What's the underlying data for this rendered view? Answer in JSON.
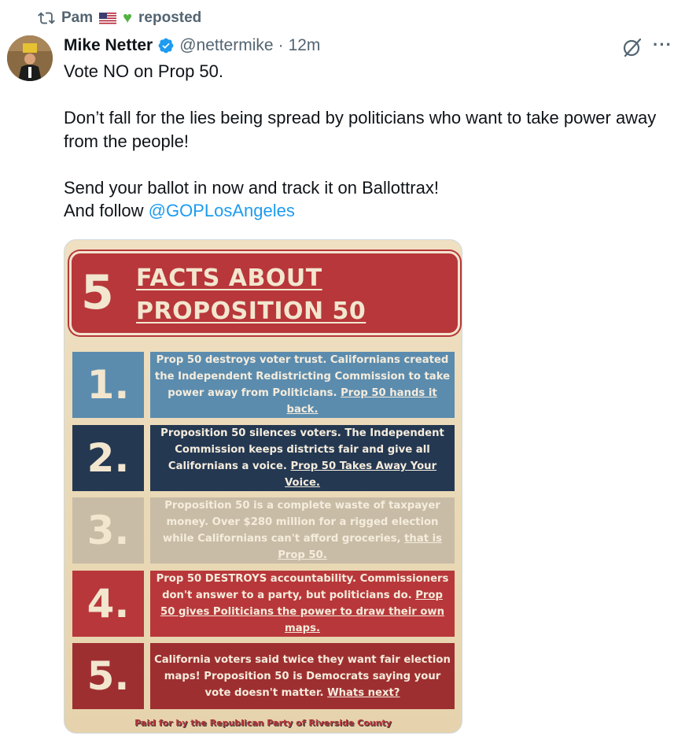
{
  "repost": {
    "user": "Pam",
    "label": "reposted"
  },
  "author": {
    "name": "Mike Netter",
    "handle": "@nettermike",
    "separator": "·",
    "time": "12m"
  },
  "tweet": {
    "line1": "Vote NO on Prop 50.",
    "line2": "Don’t fall for the lies being spread by politicians who want to take power away from the people!",
    "line3a": "Send your ballot in now and track it on Ballottrax!",
    "line3b_prefix": "And follow ",
    "mention": "@GOPLosAngeles"
  },
  "image": {
    "banner_number": "5",
    "banner_line1": "FACTS ABOUT",
    "banner_line2": "PROPOSITION 50",
    "facts": [
      {
        "num": "1.",
        "text": "Prop 50 destroys voter trust. Californians created the Independent Redistricting Commission to take power away from Politicians.",
        "emph": "Prop 50 hands it back."
      },
      {
        "num": "2.",
        "text": "Proposition 50 silences voters. The Independent Commission keeps districts fair and give all Californians a voice.",
        "emph": "Prop 50 Takes Away Your Voice."
      },
      {
        "num": "3.",
        "text": "Proposition 50 is a complete waste of taxpayer money. Over $280 million for a rigged election while Californians can't afford groceries,",
        "emph": "that is Prop 50."
      },
      {
        "num": "4.",
        "text": "Prop 50 DESTROYS accountability. Commissioners don't answer to a party, but politicians do.",
        "emph": "Prop 50 gives Politicians the power to draw their own maps."
      },
      {
        "num": "5.",
        "text": "California voters said twice they want fair election maps! Proposition 50 is Democrats saying your vote doesn't matter.",
        "emph": "Whats next?"
      }
    ],
    "paid_for": "Paid for by the Republican Party of Riverside County"
  },
  "colors": {
    "link": "#1d9bf0",
    "verified": "#1d9bf0",
    "banner_red": "#b8373a",
    "fact_blue": "#5b8cae",
    "fact_navy": "#243852",
    "fact_tan": "#c8bca6",
    "fact_red": "#b8373a",
    "fact_darkred": "#9e2f31"
  },
  "icons": {
    "repost": "repost-icon",
    "flag": "us-flag-icon",
    "heart": "green-heart-icon",
    "verified": "verified-badge-icon",
    "grok": "grok-icon",
    "more": "more-dots-icon"
  }
}
